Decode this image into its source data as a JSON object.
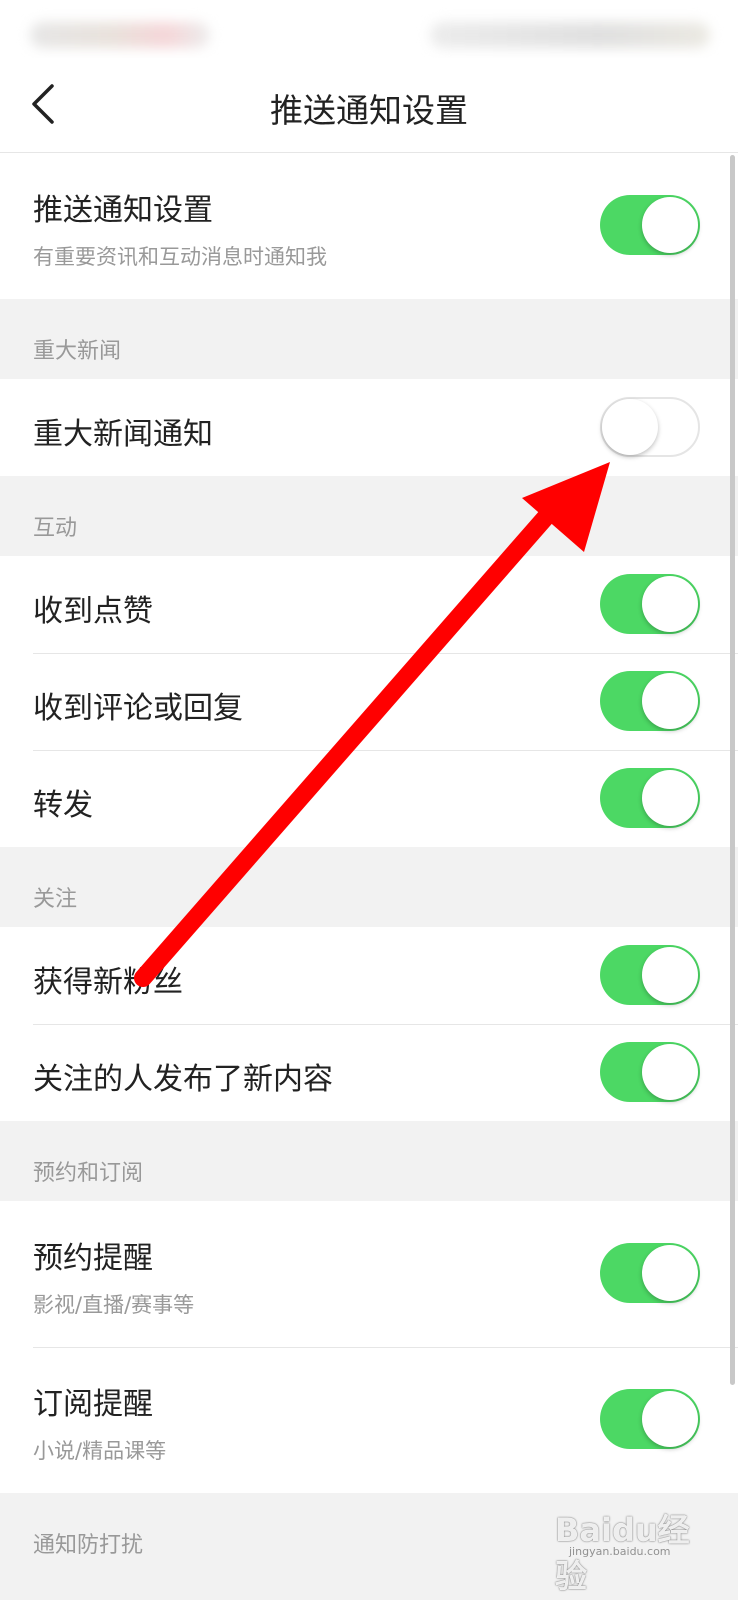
{
  "header": {
    "title": "推送通知设置"
  },
  "top_setting": {
    "label": "推送通知设置",
    "subtitle": "有重要资讯和互动消息时通知我",
    "on": true
  },
  "sections": [
    {
      "header": "重大新闻",
      "items": [
        {
          "label": "重大新闻通知",
          "on": false
        }
      ]
    },
    {
      "header": "互动",
      "items": [
        {
          "label": "收到点赞",
          "on": true
        },
        {
          "label": "收到评论或回复",
          "on": true
        },
        {
          "label": "转发",
          "on": true
        }
      ]
    },
    {
      "header": "关注",
      "items": [
        {
          "label": "获得新粉丝",
          "on": true
        },
        {
          "label": "关注的人发布了新内容",
          "on": true
        }
      ]
    },
    {
      "header": "预约和订阅",
      "items": [
        {
          "label": "预约提醒",
          "subtitle": "影视/直播/赛事等",
          "on": true
        },
        {
          "label": "订阅提醒",
          "subtitle": "小说/精品课等",
          "on": true
        }
      ]
    },
    {
      "header": "通知防打扰",
      "items": []
    }
  ],
  "colors": {
    "toggle_on": "#4cd864",
    "annotation_arrow": "#ff0000"
  },
  "icons": {
    "back": "chevron-left-icon",
    "annotation": "red-arrow-annotation"
  },
  "watermark": {
    "text": "Baidu经验",
    "sub": "jingyan.baidu.com"
  }
}
